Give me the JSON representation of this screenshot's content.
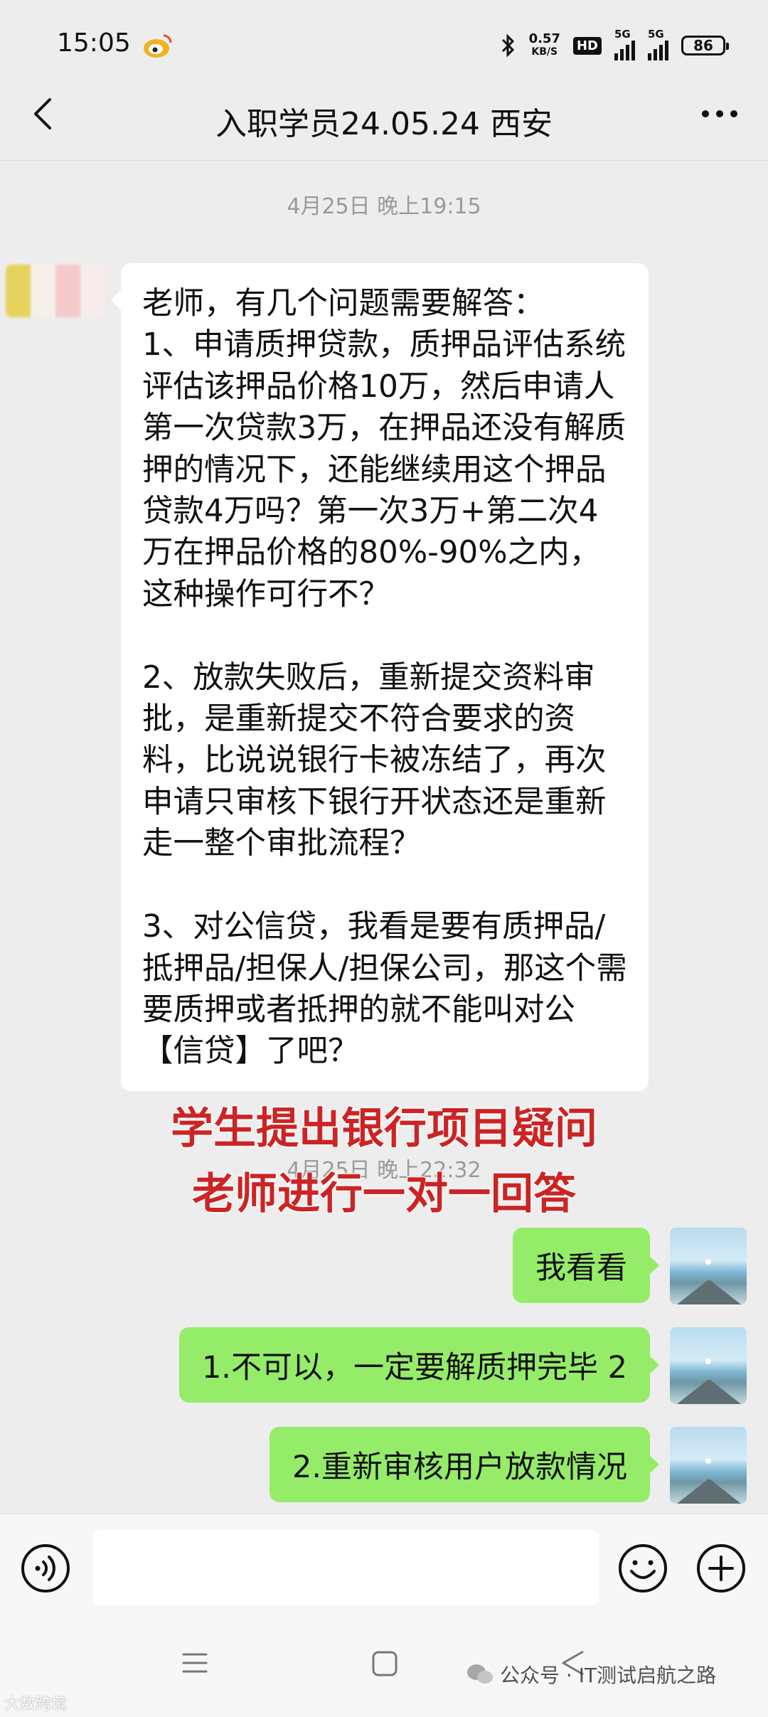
{
  "status_bar": {
    "time": "15:05",
    "net_speed_value": "0.57",
    "net_speed_unit": "KB/S",
    "hd_label": "HD",
    "signal1_label": "5G",
    "signal2_label": "5G",
    "battery": "86",
    "icons": [
      "weibo-icon",
      "bluetooth-icon",
      "signal-icon",
      "battery-icon"
    ]
  },
  "header": {
    "title": "入职学员24.05.24 西安",
    "back_icon": "chevron-left-icon",
    "more_icon": "more-dots-icon"
  },
  "messages": {
    "timestamp_1": "4月25日 晚上19:15",
    "incoming_text": "老师，有几个问题需要解答：\n1、申请质押贷款，质押品评估系统评估该押品价格10万，然后申请人第一次贷款3万，在押品还没有解质押的情况下，还能继续用这个押品贷款4万吗？第一次3万+第二次4万在押品价格的80%-90%之内，这种操作可行不？\n\n2、放款失败后，重新提交资料审批，是重新提交不符合要求的资料，比说说银行卡被冻结了，再次申请只审核下银行开状态还是重新走一整个审批流程？\n\n3、对公信贷，我看是要有质押品/抵押品/担保人/担保公司，那这个需要质押或者抵押的就不能叫对公【信贷】了吧？",
    "timestamp_2": "4月25日 晚上22:32",
    "outgoing": [
      {
        "text": "我看看"
      },
      {
        "text": "1.不可以，一定要解质押完毕 2"
      },
      {
        "text": "2.重新审核用户放款情况"
      }
    ]
  },
  "overlay_caption": {
    "line1": "学生提出银行项目疑问",
    "line2": "老师进行一对一回答"
  },
  "input_bar": {
    "value": "",
    "placeholder": "",
    "icons": [
      "voice-icon",
      "emoji-icon",
      "plus-icon"
    ]
  },
  "system_nav": {
    "icons": [
      "menu-icon",
      "home-icon",
      "back-icon"
    ]
  },
  "watermark": {
    "text": "公众号 · IT测试启航之路",
    "corner_text": "大数跨境"
  },
  "colors": {
    "background": "#ededed",
    "incoming_bubble": "#ffffff",
    "outgoing_bubble": "#95ec69",
    "caption": "#cc2424",
    "timestamp": "#9a9a9a"
  }
}
